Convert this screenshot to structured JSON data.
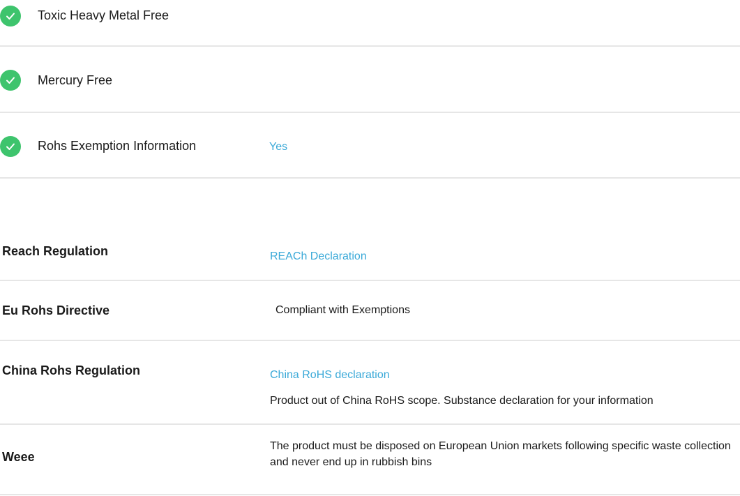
{
  "compliance_checks": [
    {
      "label": "Toxic Heavy Metal Free",
      "value": "",
      "icon": "check-circle-icon"
    },
    {
      "label": "Mercury Free",
      "value": "",
      "icon": "check-circle-icon"
    },
    {
      "label": "Rohs Exemption Information",
      "value": "Yes",
      "icon": "check-circle-icon"
    }
  ],
  "regulations": {
    "reach": {
      "label": "Reach Regulation",
      "link": "REACh Declaration"
    },
    "eu_rohs": {
      "label": "Eu Rohs Directive",
      "text": "Compliant with Exemptions"
    },
    "china_rohs": {
      "label": "China Rohs Regulation",
      "link": "China RoHS declaration",
      "note": "Product out of China RoHS scope. Substance declaration for your information"
    },
    "weee": {
      "label": "Weee",
      "text": "The product must be disposed on European Union markets following specific waste collection and never end up in rubbish bins"
    }
  },
  "colors": {
    "check_green": "#3ec46d",
    "link_blue": "#3aa9d8",
    "divider": "#e6e6e6"
  }
}
